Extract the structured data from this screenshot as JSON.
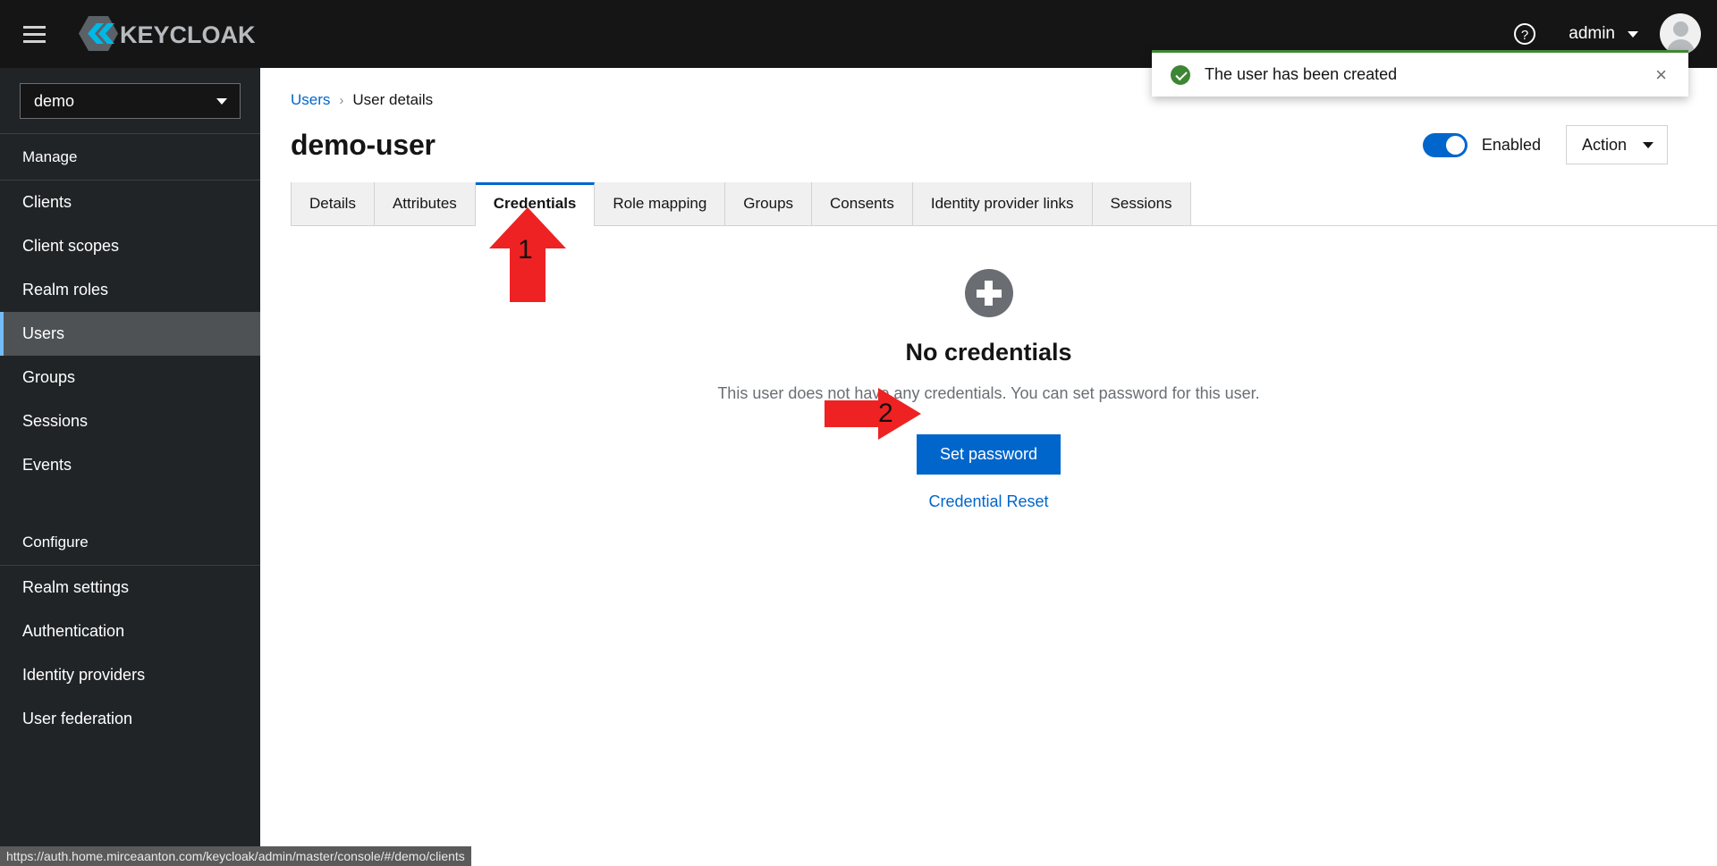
{
  "masthead": {
    "hamburger_label": "Global navigation",
    "brand_text": "KEYCLOAK",
    "help_label": "?",
    "username": "admin"
  },
  "sidebar": {
    "realm": {
      "value": "demo"
    },
    "sections": [
      {
        "title": "Manage",
        "items": [
          {
            "label": "Clients",
            "active": false
          },
          {
            "label": "Client scopes",
            "active": false
          },
          {
            "label": "Realm roles",
            "active": false
          },
          {
            "label": "Users",
            "active": true
          },
          {
            "label": "Groups",
            "active": false
          },
          {
            "label": "Sessions",
            "active": false
          },
          {
            "label": "Events",
            "active": false
          }
        ]
      },
      {
        "title": "Configure",
        "items": [
          {
            "label": "Realm settings",
            "active": false
          },
          {
            "label": "Authentication",
            "active": false
          },
          {
            "label": "Identity providers",
            "active": false
          },
          {
            "label": "User federation",
            "active": false
          }
        ]
      }
    ]
  },
  "breadcrumb": {
    "parent": "Users",
    "separator": "›",
    "current": "User details"
  },
  "page": {
    "title": "demo-user",
    "enabled_label": "Enabled",
    "action_label": "Action"
  },
  "tabs": [
    {
      "label": "Details",
      "active": false
    },
    {
      "label": "Attributes",
      "active": false
    },
    {
      "label": "Credentials",
      "active": true
    },
    {
      "label": "Role mapping",
      "active": false
    },
    {
      "label": "Groups",
      "active": false
    },
    {
      "label": "Consents",
      "active": false
    },
    {
      "label": "Identity provider links",
      "active": false
    },
    {
      "label": "Sessions",
      "active": false
    }
  ],
  "empty_state": {
    "icon": "plus-circle-icon",
    "title": "No credentials",
    "body": "This user does not have any credentials. You can set password for this user.",
    "primary_button": "Set password",
    "secondary_link": "Credential Reset"
  },
  "toast": {
    "icon": "check-circle-icon",
    "message": "The user has been created",
    "close_label": "×",
    "accent_color": "#3e8635"
  },
  "annotations": [
    {
      "number": "1",
      "target": "Credentials tab",
      "direction": "up",
      "color": "#ee2222"
    },
    {
      "number": "2",
      "target": "Set password button",
      "direction": "right",
      "color": "#ee2222"
    }
  ],
  "statusbar": {
    "url": "https://auth.home.mirceaanton.com/keycloak/admin/master/console/#/demo/clients"
  },
  "colors": {
    "accent_blue": "#0066cc",
    "masthead_bg": "#151515",
    "sidebar_bg": "#212427",
    "active_nav_bg": "#4f5255",
    "active_nav_border": "#73bcf7",
    "success_green": "#3e8635",
    "annotation_red": "#ee2222"
  }
}
